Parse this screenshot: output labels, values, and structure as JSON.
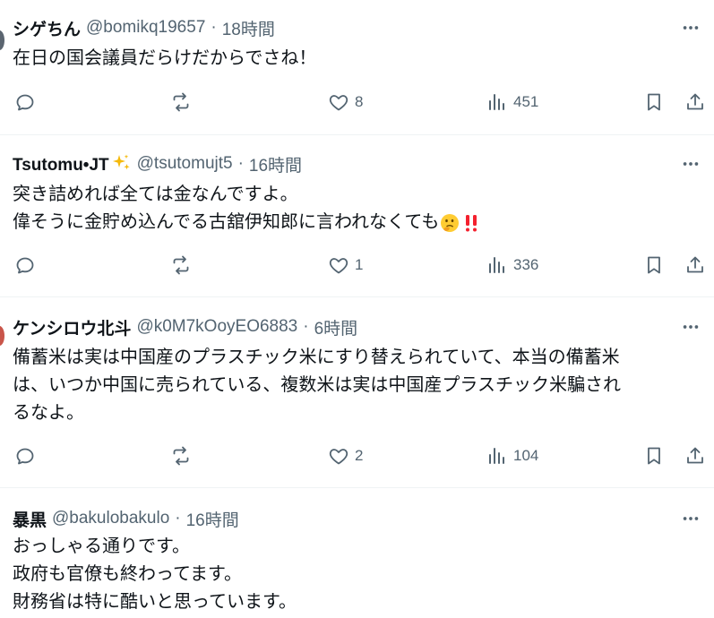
{
  "tweets": [
    {
      "name": "シゲちん",
      "handle": "@bomikq19657",
      "time": "18時間",
      "lines": [
        "在日の国会議員だらけだからでさね！"
      ],
      "likes": "8",
      "views": "451"
    },
    {
      "name": "Tsutomu•JT",
      "handle": "@tsutomujt5",
      "time": "16時間",
      "lines": [
        "突き詰めれば全ては金なんですよ。",
        "偉そうに金貯め込んでる古舘伊知郎に言われなくても"
      ],
      "likes": "1",
      "views": "336"
    },
    {
      "name": "ケンシロウ北斗",
      "handle": "@k0M7kOoyEO6883",
      "time": "6時間",
      "lines": [
        "備蓄米は実は中国産のプラスチック米にすり替えられていて、本当の備蓄米",
        "は、いつか中国に売られている、複数米は実は中国産プラスチック米騙され",
        "るなよ。"
      ],
      "likes": "2",
      "views": "104"
    },
    {
      "name": "暴黒",
      "handle": "@bakulobakulo",
      "time": "16時間",
      "lines": [
        "おっしゃる通りです。",
        "政府も官僚も終わってます。",
        "財務省は特に酷いと思っています。"
      ]
    }
  ],
  "colors": {
    "text": "#0f1419",
    "muted": "#536471",
    "divider": "#eff3f4",
    "exclaim": "#f4212e"
  },
  "icons": [
    "reply-icon",
    "retweet-icon",
    "like-icon",
    "views-icon",
    "bookmark-icon",
    "share-icon",
    "more-icon",
    "sparkles-icon",
    "thinking-face-icon",
    "double-exclamation-icon"
  ]
}
